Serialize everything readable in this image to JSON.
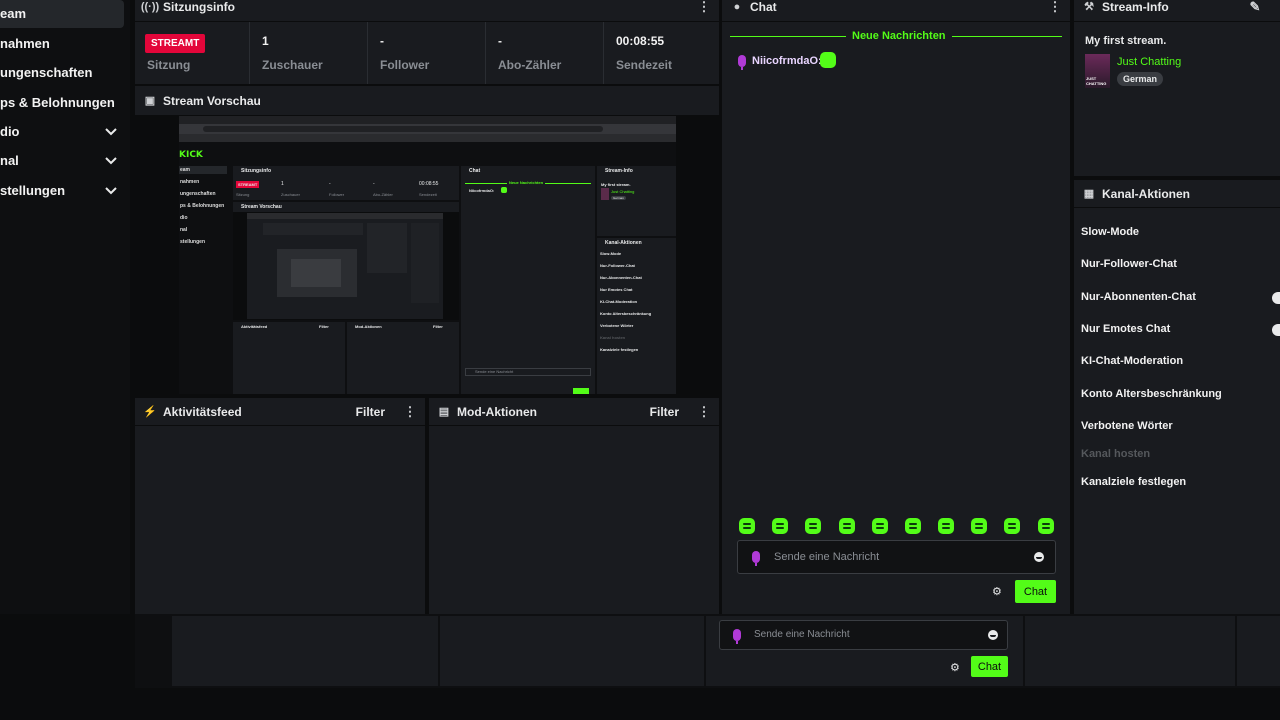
{
  "sidebar": {
    "items": [
      {
        "label": "eam",
        "has_chevron": false
      },
      {
        "label": "nahmen",
        "has_chevron": false
      },
      {
        "label": "ungenschaften",
        "has_chevron": false
      },
      {
        "label": "ps & Belohnungen",
        "has_chevron": false
      },
      {
        "label": "dio",
        "has_chevron": true
      },
      {
        "label": "nal",
        "has_chevron": true
      },
      {
        "label": "stellungen",
        "has_chevron": true
      }
    ]
  },
  "session": {
    "title": "Sitzungsinfo",
    "live_badge": "STREAMT",
    "stats": [
      {
        "value": "",
        "label": "Sitzung"
      },
      {
        "value": "1",
        "label": "Zuschauer"
      },
      {
        "value": "-",
        "label": "Follower"
      },
      {
        "value": "-",
        "label": "Abo-Zähler"
      },
      {
        "value": "00:08:55",
        "label": "Sendezeit"
      }
    ]
  },
  "preview": {
    "title": "Stream Vorschau",
    "inner_logo": "KICK",
    "inner_headers": [
      "Sitzungsinfo",
      "Chat",
      "Stream-Info",
      "Stream Vorschau",
      "Aktivitätsfeed",
      "Mod-Aktionen",
      "Kanal-Aktionen"
    ],
    "inner_sidebar": [
      "eam",
      "nahmen",
      "ungenschaften",
      "ps & Belohnungen",
      "dio",
      "nal",
      "stellungen"
    ],
    "inner_stats": [
      {
        "value": "STREAMT",
        "label": "Sitzung"
      },
      {
        "value": "1",
        "label": "Zuschauer"
      },
      {
        "value": "-",
        "label": "Follower"
      },
      {
        "value": "-",
        "label": "Abo-Zähler"
      },
      {
        "value": "00:08:55",
        "label": "Sendezeit"
      }
    ],
    "inner_new_messages": "Neue Nachrichten",
    "inner_chat_user": "NiicofrmdaO:",
    "inner_stream_title": "My first stream.",
    "inner_category": "Just Chatting",
    "inner_language": "German",
    "inner_actions": [
      "Slow-Mode",
      "Nur-Follower-Chat",
      "Nur-Abonnenten-Chat",
      "Nur Emotes Chat",
      "KI-Chat-Moderation",
      "Konto Altersbeschränkung",
      "Verbotene Wörter",
      "Kanal hosten",
      "Kanalziele festlegen"
    ],
    "inner_input_placeholder": "Sende eine Nachricht",
    "inner_filter": "Filter"
  },
  "activity": {
    "title": "Aktivitätsfeed",
    "filter": "Filter"
  },
  "mod": {
    "title": "Mod-Aktionen",
    "filter": "Filter"
  },
  "chat": {
    "title": "Chat",
    "new_messages": "Neue Nachrichten",
    "messages": [
      {
        "user": "NiicofrmdaO:",
        "user_color": "#e9d5ff"
      }
    ],
    "emote_count": 10,
    "input_placeholder": "Sende eine Nachricht",
    "send_label": "Chat"
  },
  "stream_info": {
    "title": "Stream-Info",
    "stream_title": "My first stream.",
    "category": "Just Chatting",
    "language": "German",
    "thumb_text": "JUST CHATTING"
  },
  "channel_actions": {
    "title": "Kanal-Aktionen",
    "items": [
      {
        "label": "Slow-Mode",
        "disabled": false,
        "toggle": false
      },
      {
        "label": "Nur-Follower-Chat",
        "disabled": false,
        "toggle": false
      },
      {
        "label": "Nur-Abonnenten-Chat",
        "disabled": false,
        "toggle": true
      },
      {
        "label": "Nur Emotes Chat",
        "disabled": false,
        "toggle": true
      },
      {
        "label": "KI-Chat-Moderation",
        "disabled": false,
        "toggle": false
      },
      {
        "label": "Konto Altersbeschränkung",
        "disabled": false,
        "toggle": false
      },
      {
        "label": "Verbotene Wörter",
        "disabled": false,
        "toggle": false
      },
      {
        "label": "Kanal hosten",
        "disabled": true,
        "toggle": false
      },
      {
        "label": "Kanalziele festlegen",
        "disabled": false,
        "toggle": false
      }
    ]
  },
  "bottom_bar": {
    "input_placeholder": "Sende eine Nachricht",
    "send_label": "Chat"
  },
  "colors": {
    "accent": "#53fc18",
    "live": "#e3063a",
    "panel": "#191b1f",
    "background": "#0b0c0d",
    "muted": "#8a8e94"
  }
}
